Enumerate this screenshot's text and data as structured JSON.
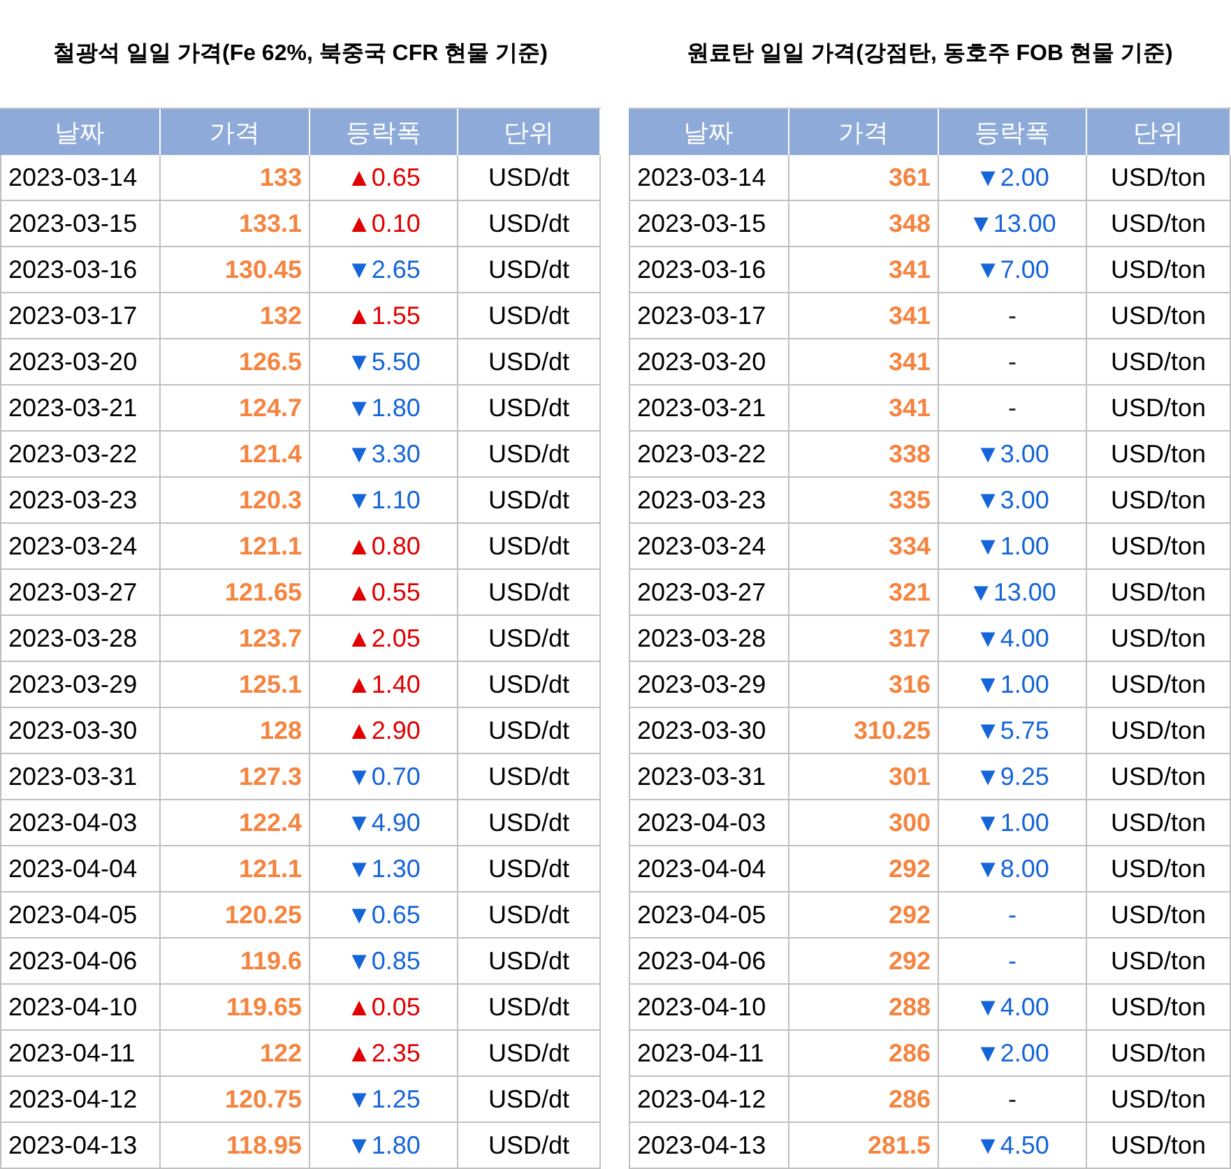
{
  "tables": [
    {
      "title": "철광석 일일 가격(Fe 62%, 북중국 CFR 현물 기준)",
      "columns": [
        "날짜",
        "가격",
        "등락폭",
        "단위"
      ],
      "rows": [
        {
          "date": "2023-03-14",
          "price": "133",
          "change": "▲0.65",
          "kind": "up",
          "unit": "USD/dt"
        },
        {
          "date": "2023-03-15",
          "price": "133.1",
          "change": "▲0.10",
          "kind": "up",
          "unit": "USD/dt"
        },
        {
          "date": "2023-03-16",
          "price": "130.45",
          "change": "▼2.65",
          "kind": "down",
          "unit": "USD/dt"
        },
        {
          "date": "2023-03-17",
          "price": "132",
          "change": "▲1.55",
          "kind": "up",
          "unit": "USD/dt"
        },
        {
          "date": "2023-03-20",
          "price": "126.5",
          "change": "▼5.50",
          "kind": "down",
          "unit": "USD/dt"
        },
        {
          "date": "2023-03-21",
          "price": "124.7",
          "change": "▼1.80",
          "kind": "down",
          "unit": "USD/dt"
        },
        {
          "date": "2023-03-22",
          "price": "121.4",
          "change": "▼3.30",
          "kind": "down",
          "unit": "USD/dt"
        },
        {
          "date": "2023-03-23",
          "price": "120.3",
          "change": "▼1.10",
          "kind": "down",
          "unit": "USD/dt"
        },
        {
          "date": "2023-03-24",
          "price": "121.1",
          "change": "▲0.80",
          "kind": "up",
          "unit": "USD/dt"
        },
        {
          "date": "2023-03-27",
          "price": "121.65",
          "change": "▲0.55",
          "kind": "up",
          "unit": "USD/dt"
        },
        {
          "date": "2023-03-28",
          "price": "123.7",
          "change": "▲2.05",
          "kind": "up",
          "unit": "USD/dt"
        },
        {
          "date": "2023-03-29",
          "price": "125.1",
          "change": "▲1.40",
          "kind": "up",
          "unit": "USD/dt"
        },
        {
          "date": "2023-03-30",
          "price": "128",
          "change": "▲2.90",
          "kind": "up",
          "unit": "USD/dt"
        },
        {
          "date": "2023-03-31",
          "price": "127.3",
          "change": "▼0.70",
          "kind": "down",
          "unit": "USD/dt"
        },
        {
          "date": "2023-04-03",
          "price": "122.4",
          "change": "▼4.90",
          "kind": "down",
          "unit": "USD/dt"
        },
        {
          "date": "2023-04-04",
          "price": "121.1",
          "change": "▼1.30",
          "kind": "down",
          "unit": "USD/dt"
        },
        {
          "date": "2023-04-05",
          "price": "120.25",
          "change": "▼0.65",
          "kind": "down",
          "unit": "USD/dt"
        },
        {
          "date": "2023-04-06",
          "price": "119.6",
          "change": "▼0.85",
          "kind": "down",
          "unit": "USD/dt"
        },
        {
          "date": "2023-04-10",
          "price": "119.65",
          "change": "▲0.05",
          "kind": "up",
          "unit": "USD/dt"
        },
        {
          "date": "2023-04-11",
          "price": "122",
          "change": "▲2.35",
          "kind": "up",
          "unit": "USD/dt"
        },
        {
          "date": "2023-04-12",
          "price": "120.75",
          "change": "▼1.25",
          "kind": "down",
          "unit": "USD/dt"
        },
        {
          "date": "2023-04-13",
          "price": "118.95",
          "change": "▼1.80",
          "kind": "down",
          "unit": "USD/dt"
        }
      ]
    },
    {
      "title": "원료탄 일일 가격(강점탄, 동호주 FOB 현물 기준)",
      "columns": [
        "날짜",
        "가격",
        "등락폭",
        "단위"
      ],
      "rows": [
        {
          "date": "2023-03-14",
          "price": "361",
          "change": "▼2.00",
          "kind": "down",
          "unit": "USD/ton"
        },
        {
          "date": "2023-03-15",
          "price": "348",
          "change": "▼13.00",
          "kind": "down",
          "unit": "USD/ton"
        },
        {
          "date": "2023-03-16",
          "price": "341",
          "change": "▼7.00",
          "kind": "down",
          "unit": "USD/ton"
        },
        {
          "date": "2023-03-17",
          "price": "341",
          "change": "-",
          "kind": "flat",
          "unit": "USD/ton"
        },
        {
          "date": "2023-03-20",
          "price": "341",
          "change": "-",
          "kind": "flat",
          "unit": "USD/ton"
        },
        {
          "date": "2023-03-21",
          "price": "341",
          "change": "-",
          "kind": "flat",
          "unit": "USD/ton"
        },
        {
          "date": "2023-03-22",
          "price": "338",
          "change": "▼3.00",
          "kind": "down",
          "unit": "USD/ton"
        },
        {
          "date": "2023-03-23",
          "price": "335",
          "change": "▼3.00",
          "kind": "down",
          "unit": "USD/ton"
        },
        {
          "date": "2023-03-24",
          "price": "334",
          "change": "▼1.00",
          "kind": "down",
          "unit": "USD/ton"
        },
        {
          "date": "2023-03-27",
          "price": "321",
          "change": "▼13.00",
          "kind": "down",
          "unit": "USD/ton"
        },
        {
          "date": "2023-03-28",
          "price": "317",
          "change": "▼4.00",
          "kind": "down",
          "unit": "USD/ton"
        },
        {
          "date": "2023-03-29",
          "price": "316",
          "change": "▼1.00",
          "kind": "down",
          "unit": "USD/ton"
        },
        {
          "date": "2023-03-30",
          "price": "310.25",
          "change": "▼5.75",
          "kind": "down",
          "unit": "USD/ton"
        },
        {
          "date": "2023-03-31",
          "price": "301",
          "change": "▼9.25",
          "kind": "down",
          "unit": "USD/ton"
        },
        {
          "date": "2023-04-03",
          "price": "300",
          "change": "▼1.00",
          "kind": "down",
          "unit": "USD/ton"
        },
        {
          "date": "2023-04-04",
          "price": "292",
          "change": "▼8.00",
          "kind": "down",
          "unit": "USD/ton"
        },
        {
          "date": "2023-04-05",
          "price": "292",
          "change": "-",
          "kind": "dash",
          "unit": "USD/ton"
        },
        {
          "date": "2023-04-06",
          "price": "292",
          "change": "-",
          "kind": "dash",
          "unit": "USD/ton"
        },
        {
          "date": "2023-04-10",
          "price": "288",
          "change": "▼4.00",
          "kind": "down",
          "unit": "USD/ton"
        },
        {
          "date": "2023-04-11",
          "price": "286",
          "change": "▼2.00",
          "kind": "down",
          "unit": "USD/ton"
        },
        {
          "date": "2023-04-12",
          "price": "286",
          "change": "-",
          "kind": "flat",
          "unit": "USD/ton"
        },
        {
          "date": "2023-04-13",
          "price": "281.5",
          "change": "▼4.50",
          "kind": "down",
          "unit": "USD/ton"
        }
      ]
    }
  ]
}
